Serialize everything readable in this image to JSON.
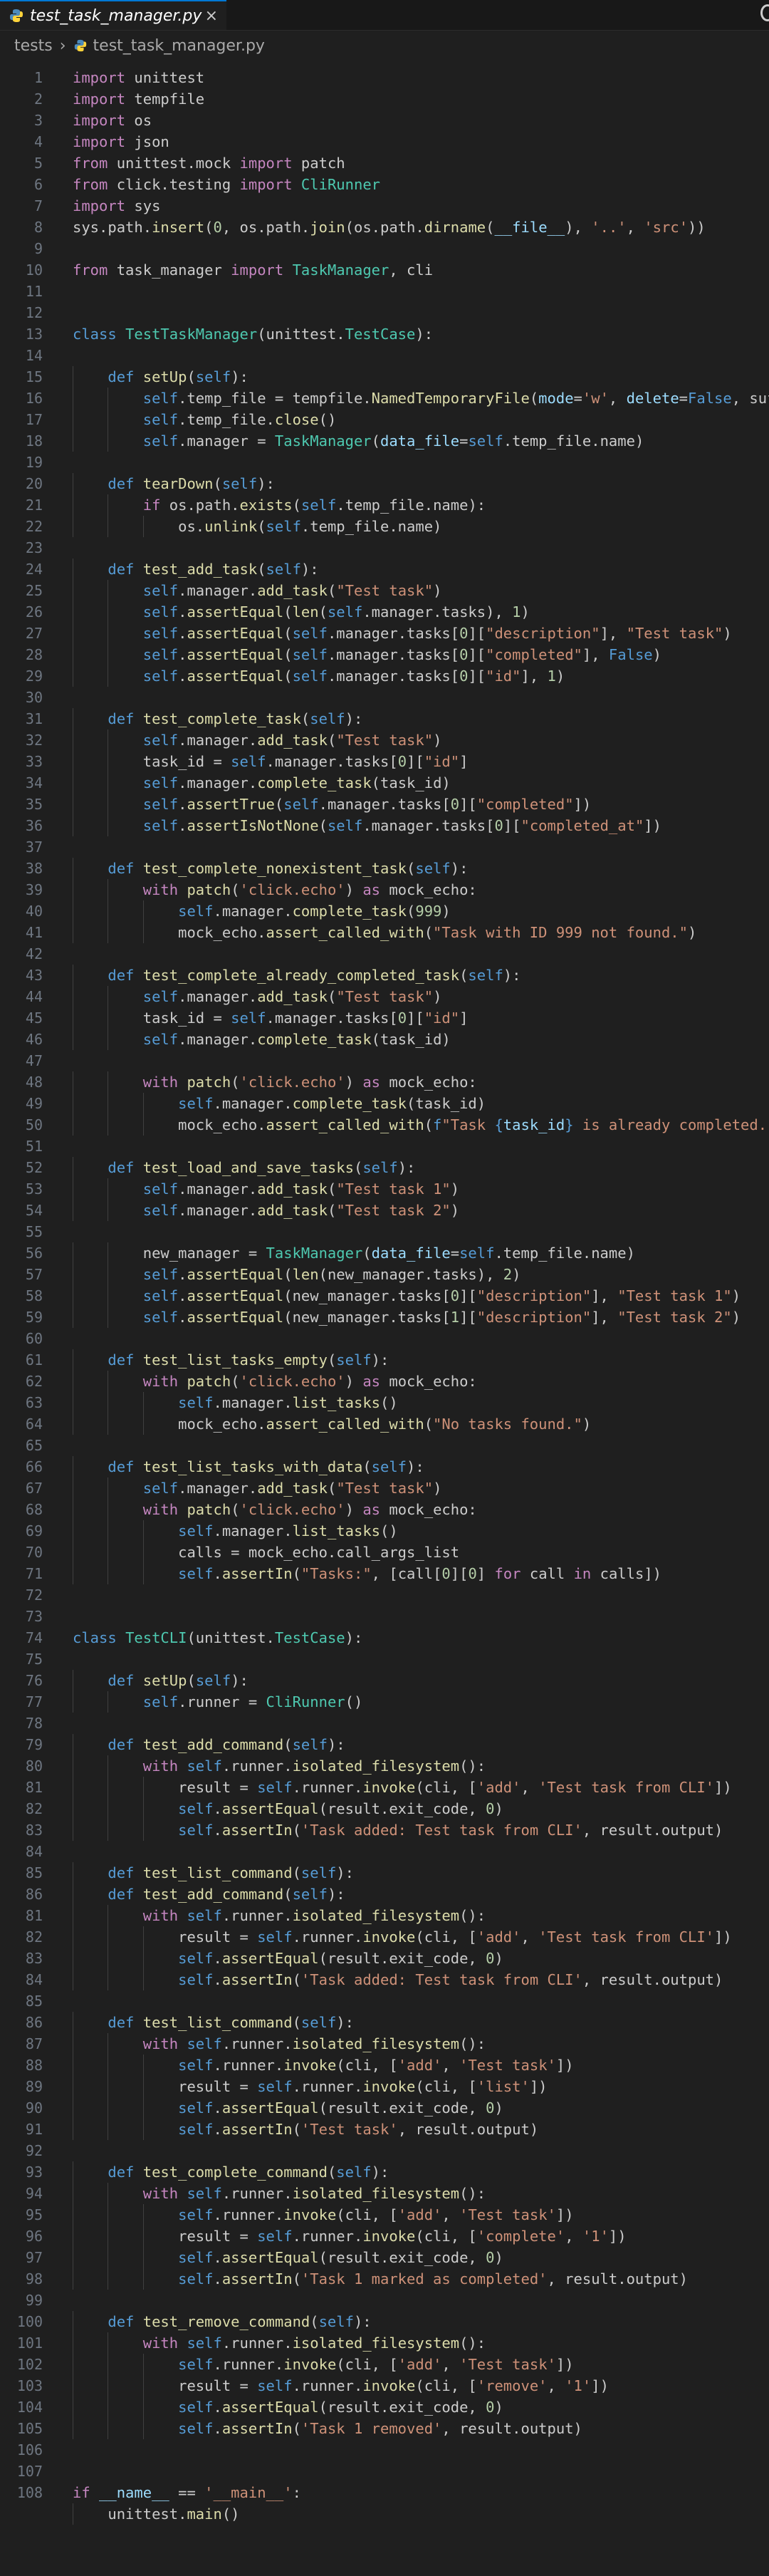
{
  "tab": {
    "filename": "test_task_manager.py",
    "close_glyph": "×",
    "icon": "python-file-icon"
  },
  "breadcrumb": {
    "folder": "tests",
    "file": "test_task_manager.py",
    "chevron": "›"
  },
  "editor": {
    "active_line": 108,
    "theme": {
      "background": "#1f1f1f",
      "keyword": "#569cd6",
      "control": "#c586c0",
      "class": "#4ec9b0",
      "function": "#dcdcaa",
      "string": "#ce9178",
      "number": "#b5cea8",
      "variable": "#9cdcfe"
    },
    "lines": [
      "import unittest",
      "import tempfile",
      "import os",
      "import json",
      "from unittest.mock import patch",
      "from click.testing import CliRunner",
      "import sys",
      "sys.path.insert(0, os.path.join(os.path.dirname(__file__), '..', 'src'))",
      "",
      "from task_manager import TaskManager, cli",
      "",
      "",
      "class TestTaskManager(unittest.TestCase):",
      "",
      "    def setUp(self):",
      "        self.temp_file = tempfile.NamedTemporaryFile(mode='w', delete=False, suffi",
      "        self.temp_file.close()",
      "        self.manager = TaskManager(data_file=self.temp_file.name)",
      "",
      "    def tearDown(self):",
      "        if os.path.exists(self.temp_file.name):",
      "            os.unlink(self.temp_file.name)",
      "",
      "    def test_add_task(self):",
      "        self.manager.add_task(\"Test task\")",
      "        self.assertEqual(len(self.manager.tasks), 1)",
      "        self.assertEqual(self.manager.tasks[0][\"description\"], \"Test task\")",
      "        self.assertEqual(self.manager.tasks[0][\"completed\"], False)",
      "        self.assertEqual(self.manager.tasks[0][\"id\"], 1)",
      "",
      "    def test_complete_task(self):",
      "        self.manager.add_task(\"Test task\")",
      "        task_id = self.manager.tasks[0][\"id\"]",
      "        self.manager.complete_task(task_id)",
      "        self.assertTrue(self.manager.tasks[0][\"completed\"])",
      "        self.assertIsNotNone(self.manager.tasks[0][\"completed_at\"])",
      "",
      "    def test_complete_nonexistent_task(self):",
      "        with patch('click.echo') as mock_echo:",
      "            self.manager.complete_task(999)",
      "            mock_echo.assert_called_with(\"Task with ID 999 not found.\")",
      "",
      "    def test_complete_already_completed_task(self):",
      "        self.manager.add_task(\"Test task\")",
      "        task_id = self.manager.tasks[0][\"id\"]",
      "        self.manager.complete_task(task_id)",
      "",
      "        with patch('click.echo') as mock_echo:",
      "            self.manager.complete_task(task_id)",
      "            mock_echo.assert_called_with(f\"Task {task_id} is already completed.\")",
      "",
      "    def test_load_and_save_tasks(self):",
      "        self.manager.add_task(\"Test task 1\")",
      "        self.manager.add_task(\"Test task 2\")",
      "",
      "        new_manager = TaskManager(data_file=self.temp_file.name)",
      "        self.assertEqual(len(new_manager.tasks), 2)",
      "        self.assertEqual(new_manager.tasks[0][\"description\"], \"Test task 1\")",
      "        self.assertEqual(new_manager.tasks[1][\"description\"], \"Test task 2\")",
      "",
      "    def test_list_tasks_empty(self):",
      "        with patch('click.echo') as mock_echo:",
      "            self.manager.list_tasks()",
      "            mock_echo.assert_called_with(\"No tasks found.\")",
      "",
      "    def test_list_tasks_with_data(self):",
      "        self.manager.add_task(\"Test task\")",
      "        with patch('click.echo') as mock_echo:",
      "            self.manager.list_tasks()",
      "            calls = mock_echo.call_args_list",
      "            self.assertIn(\"Tasks:\", [call[0][0] for call in calls])",
      "",
      "",
      "class TestCLI(unittest.TestCase):",
      "",
      "    def setUp(self):",
      "        self.runner = CliRunner()",
      "",
      "    def test_add_command(self):",
      "        with self.runner.isolated_filesystem():",
      "            result = self.runner.invoke(cli, ['add', 'Test task from CLI'])",
      "            self.assertEqual(result.exit_code, 0)",
      "            self.assertIn('Task added: Test task from CLI', result.output)",
      "",
      "    def test_list_command(self):",
      "    def test_add_command(self):",
      "        with self.runner.isolated_filesystem():",
      "            result = self.runner.invoke(cli, ['add', 'Test task from CLI'])",
      "            self.assertEqual(result.exit_code, 0)",
      "            self.assertIn('Task added: Test task from CLI', result.output)",
      "",
      "    def test_list_command(self):",
      "        with self.runner.isolated_filesystem():",
      "            self.runner.invoke(cli, ['add', 'Test task'])",
      "            result = self.runner.invoke(cli, ['list'])",
      "            self.assertEqual(result.exit_code, 0)",
      "            self.assertIn('Test task', result.output)",
      "",
      "    def test_complete_command(self):",
      "        with self.runner.isolated_filesystem():",
      "            self.runner.invoke(cli, ['add', 'Test task'])",
      "            result = self.runner.invoke(cli, ['complete', '1'])",
      "            self.assertEqual(result.exit_code, 0)",
      "            self.assertIn('Task 1 marked as completed', result.output)",
      "",
      "    def test_remove_command(self):",
      "        with self.runner.isolated_filesystem():",
      "            self.runner.invoke(cli, ['add', 'Test task'])",
      "            result = self.runner.invoke(cli, ['remove', '1'])",
      "            self.assertEqual(result.exit_code, 0)",
      "            self.assertIn('Task 1 removed', result.output)",
      "",
      "",
      "if __name__ == '__main__':",
      "    unittest.main()"
    ],
    "line_numbers": [
      1,
      2,
      3,
      4,
      5,
      6,
      7,
      8,
      9,
      10,
      11,
      12,
      13,
      14,
      15,
      16,
      17,
      18,
      19,
      20,
      21,
      22,
      23,
      24,
      25,
      26,
      27,
      28,
      29,
      30,
      31,
      32,
      33,
      34,
      35,
      36,
      37,
      38,
      39,
      40,
      41,
      42,
      43,
      44,
      45,
      46,
      47,
      48,
      49,
      50,
      51,
      52,
      53,
      54,
      55,
      56,
      57,
      58,
      59,
      60,
      61,
      62,
      63,
      64,
      65,
      66,
      67,
      68,
      69,
      70,
      71,
      72,
      73,
      74,
      75,
      76,
      77,
      78,
      79,
      80,
      81,
      82,
      83,
      84,
      85,
      86,
      81,
      82,
      83,
      84,
      85,
      86,
      87,
      88,
      89,
      90,
      91,
      92,
      93,
      94,
      95,
      96,
      97,
      98,
      99,
      100,
      101,
      102,
      103,
      104,
      105,
      106,
      107,
      108
    ]
  }
}
